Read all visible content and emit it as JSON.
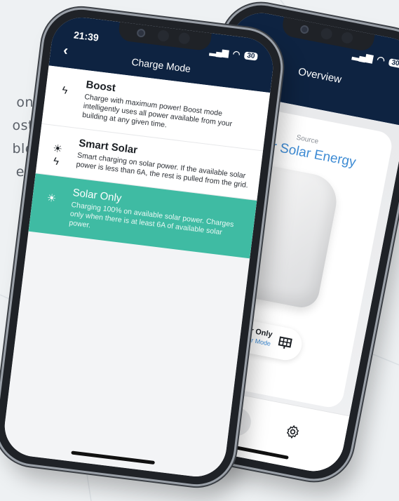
{
  "intro_text": [
    "on",
    "ost",
    "ble",
    "er."
  ],
  "overview": {
    "title": "Overview",
    "battery": "30",
    "source_label": "Source",
    "source_value": "I for Solar Energy",
    "charger_mode_value": "Solar Only",
    "charger_mode_label": "Charger Mode"
  },
  "charge_mode": {
    "time": "21:39",
    "battery": "30",
    "title": "Charge Mode",
    "back_icon": "chevron-left-icon",
    "modes": [
      {
        "name": "Boost",
        "description": "Charge with maximum power! Boost mode intelligently uses all power available from your building at any given time.",
        "icon": "lightning-icon",
        "selected": false
      },
      {
        "name": "Smart Solar",
        "description": "Smart charging on solar power. If the available solar power is less than 6A, the rest is pulled from the grid.",
        "icon": "sun-lightning-icon",
        "selected": false
      },
      {
        "name": "Solar Only",
        "description": "Charging 100% on available solar power. Charges only when there is at least 6A of available solar power.",
        "icon": "sun-icon",
        "selected": true
      }
    ]
  },
  "colors": {
    "header": "#0e2341",
    "selected": "#3fbba3",
    "accent_blue": "#3d8bd4"
  }
}
